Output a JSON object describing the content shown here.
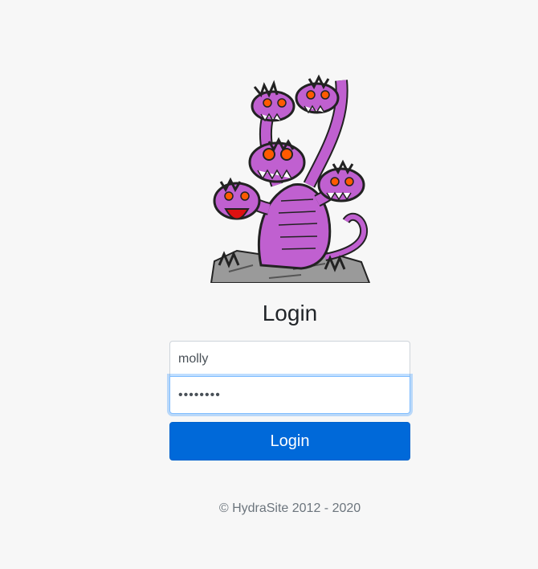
{
  "login": {
    "title": "Login",
    "username_value": "molly",
    "password_value": "••••••••",
    "button_label": "Login"
  },
  "footer": {
    "copyright": "© HydraSite 2012 - 2020"
  },
  "colors": {
    "accent": "#0069d9",
    "background": "#f7f7f7",
    "hydra": "#c060d0"
  },
  "logo": {
    "icon": "hydra-logo-icon"
  }
}
